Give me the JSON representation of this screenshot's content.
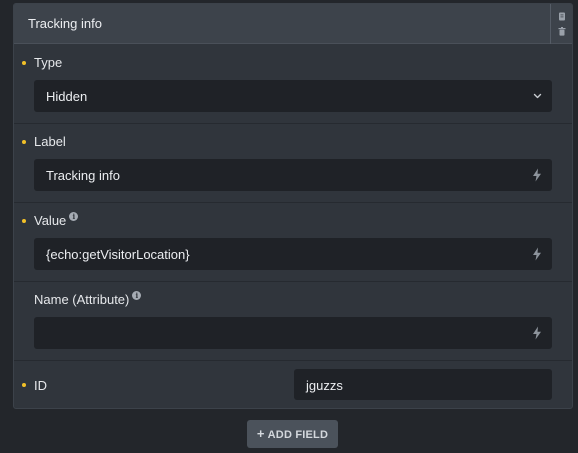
{
  "panel": {
    "title": "Tracking info"
  },
  "fields": {
    "type": {
      "label": "Type",
      "value": "Hidden"
    },
    "label": {
      "label": "Label",
      "value": "Tracking info"
    },
    "value": {
      "label": "Value",
      "value": "{echo:getVisitorLocation}"
    },
    "name_attribute": {
      "label": "Name (Attribute)",
      "value": ""
    },
    "id": {
      "label": "ID",
      "value": "jguzzs"
    }
  },
  "add_field_label": "ADD FIELD",
  "add_field_plus": "+",
  "info_glyph": "i",
  "colors": {
    "required_dot": "#f2c028",
    "panel_bg": "#30353c",
    "input_bg": "#1f2227"
  },
  "icons": [
    "copy-icon",
    "trash-icon",
    "chevron-down-icon",
    "lightning-icon",
    "info-icon"
  ]
}
